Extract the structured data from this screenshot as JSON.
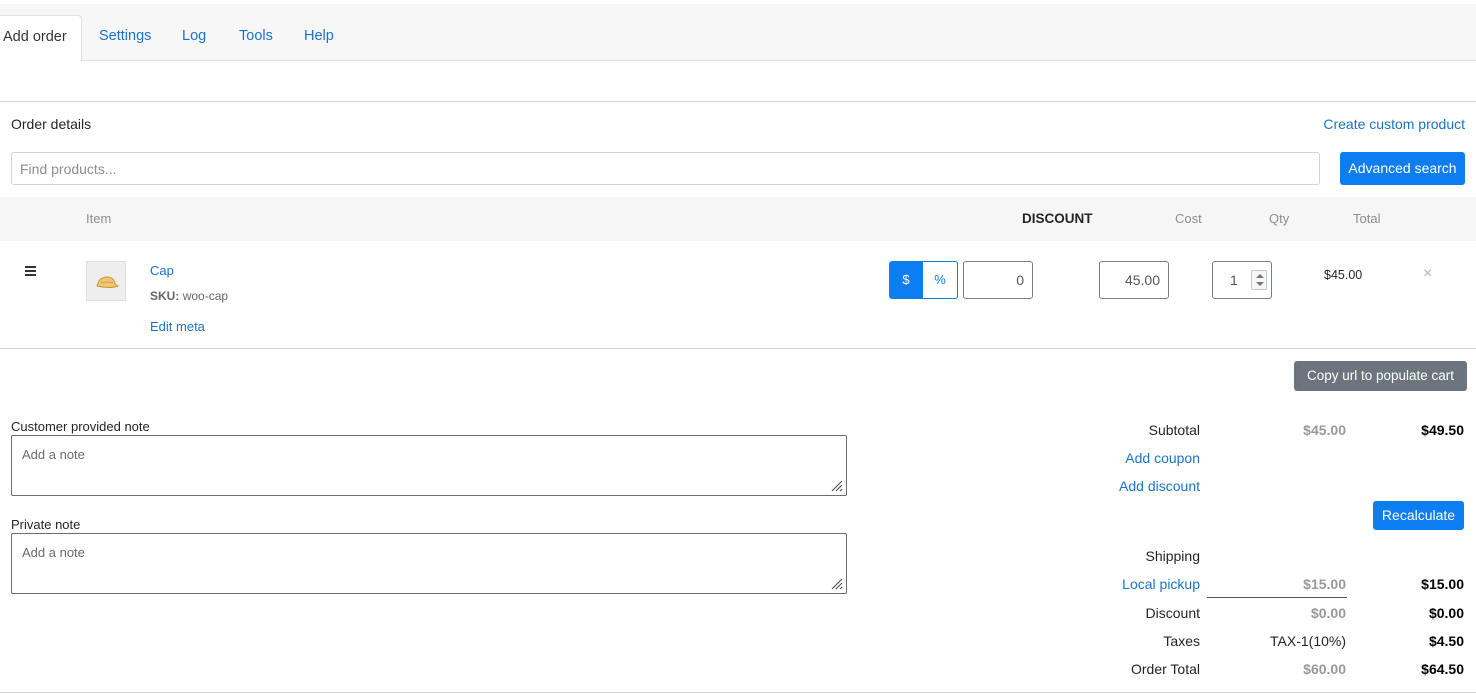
{
  "tabs": [
    {
      "label": "Add order",
      "active": true
    },
    {
      "label": "Settings"
    },
    {
      "label": "Log"
    },
    {
      "label": "Tools"
    },
    {
      "label": "Help"
    }
  ],
  "order": {
    "title": "Order details",
    "create_custom_link": "Create custom product",
    "search_placeholder": "Find products...",
    "advanced_search_label": "Advanced search"
  },
  "table": {
    "headers": {
      "item": "Item",
      "discount": "DISCOUNT",
      "cost": "Cost",
      "qty": "Qty",
      "total": "Total"
    },
    "rows": [
      {
        "name": "Cap",
        "sku_label": "SKU:",
        "sku": "woo-cap",
        "edit_meta": "Edit meta",
        "discount_type_dollar": "$",
        "discount_type_percent": "%",
        "discount_value": "0",
        "cost": "45.00",
        "qty": "1",
        "total": "$45.00",
        "remove": "×"
      }
    ]
  },
  "copy_url_label": "Copy url to populate cart",
  "notes": {
    "customer_label": "Customer provided note",
    "customer_placeholder": "Add a note",
    "private_label": "Private note",
    "private_placeholder": "Add a note"
  },
  "totals": {
    "subtotal_label": "Subtotal",
    "subtotal_orig": "$45.00",
    "subtotal": "$49.50",
    "add_coupon": "Add coupon",
    "add_discount": "Add discount",
    "recalculate": "Recalculate",
    "shipping_label": "Shipping",
    "shipping_method": "Local pickup",
    "shipping_orig": "$15.00",
    "shipping": "$15.00",
    "discount_label": "Discount",
    "discount_orig": "$0.00",
    "discount": "$0.00",
    "taxes_label": "Taxes",
    "tax_name": "TAX-1(10%)",
    "taxes": "$4.50",
    "order_total_label": "Order Total",
    "order_total_orig": "$60.00",
    "order_total": "$64.50"
  },
  "colors": {
    "accent": "#0d7ef0",
    "link": "#1a73c8",
    "muted_button": "#6c757d"
  }
}
